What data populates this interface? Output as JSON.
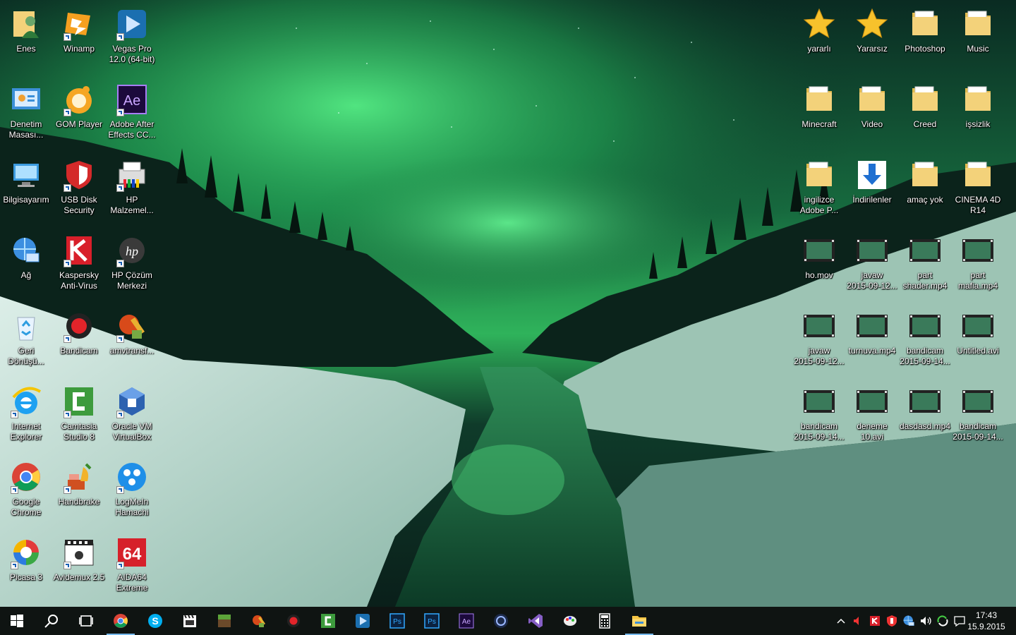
{
  "desktop": {
    "left_icons": [
      {
        "label": "Enes",
        "icon": "user-folder-icon"
      },
      {
        "label": "Winamp",
        "icon": "winamp-icon"
      },
      {
        "label": "Vegas Pro\n12.0 (64-bit)",
        "icon": "vegas-pro-icon"
      },
      {
        "label": "Denetim\nMasası...",
        "icon": "control-panel-icon"
      },
      {
        "label": "GOM Player",
        "icon": "gom-player-icon"
      },
      {
        "label": "Adobe After\nEffects CC...",
        "icon": "after-effects-icon"
      },
      {
        "label": "Bilgisayarım",
        "icon": "computer-icon"
      },
      {
        "label": "USB Disk\nSecurity",
        "icon": "usb-disk-security-icon"
      },
      {
        "label": "HP\nMalzemel...",
        "icon": "hp-printer-icon"
      },
      {
        "label": "Ağ",
        "icon": "network-icon"
      },
      {
        "label": "Kaspersky\nAnti-Virus",
        "icon": "kaspersky-icon"
      },
      {
        "label": "HP Çözüm\nMerkezi",
        "icon": "hp-solution-center-icon"
      },
      {
        "label": "Geri\nDönüşü...",
        "icon": "recycle-bin-icon"
      },
      {
        "label": "Bandicam",
        "icon": "bandicam-icon"
      },
      {
        "label": "amvtransf...",
        "icon": "amvtransformer-icon"
      },
      {
        "label": "Internet\nExplorer",
        "icon": "internet-explorer-icon"
      },
      {
        "label": "Camtasia\nStudio 8",
        "icon": "camtasia-icon"
      },
      {
        "label": "Oracle VM\nVirtualBox",
        "icon": "virtualbox-icon"
      },
      {
        "label": "Google\nChrome",
        "icon": "chrome-icon"
      },
      {
        "label": "Handbrake",
        "icon": "handbrake-icon"
      },
      {
        "label": "LogMeIn\nHamachi",
        "icon": "hamachi-icon"
      },
      {
        "label": "Picasa 3",
        "icon": "picasa-icon"
      },
      {
        "label": "Avidemux 2.5",
        "icon": "avidemux-icon"
      },
      {
        "label": "AIDA64\nExtreme",
        "icon": "aida64-icon"
      }
    ],
    "right_icons": [
      {
        "label": "yararlı",
        "icon": "star-icon"
      },
      {
        "label": "Yararsız",
        "icon": "star-icon"
      },
      {
        "label": "Photoshop",
        "icon": "folder-icon"
      },
      {
        "label": "Music",
        "icon": "folder-icon"
      },
      {
        "label": "Minecraft",
        "icon": "folder-icon"
      },
      {
        "label": "Video",
        "icon": "folder-icon"
      },
      {
        "label": "Creed",
        "icon": "folder-icon"
      },
      {
        "label": "işsizlik",
        "icon": "folder-icon"
      },
      {
        "label": "ingilizce\nAdobe P...",
        "icon": "folder-icon"
      },
      {
        "label": "İndirilenler",
        "icon": "downloads-icon"
      },
      {
        "label": "amaç yok",
        "icon": "folder-icon"
      },
      {
        "label": "CINEMA 4D\nR14",
        "icon": "folder-icon"
      },
      {
        "label": "ho.mov",
        "icon": "video-file-icon"
      },
      {
        "label": "javaw\n2015-09-12...",
        "icon": "video-file-icon"
      },
      {
        "label": "part\nshader.mp4",
        "icon": "video-file-icon"
      },
      {
        "label": "part\nmafia.mp4",
        "icon": "video-file-icon"
      },
      {
        "label": "javaw\n2015-09-12...",
        "icon": "video-file-icon"
      },
      {
        "label": "turnuva.mp4",
        "icon": "video-file-icon"
      },
      {
        "label": "bandicam\n2015-09-14...",
        "icon": "video-file-icon"
      },
      {
        "label": "Untitled.avi",
        "icon": "video-file-icon"
      },
      {
        "label": "bandicam\n2015-09-14...",
        "icon": "video-file-icon"
      },
      {
        "label": "deneme\n10.avi",
        "icon": "video-file-icon"
      },
      {
        "label": "dasdasd.mp4",
        "icon": "video-file-icon"
      },
      {
        "label": "bandicam\n2015-09-14...",
        "icon": "video-file-icon"
      }
    ]
  },
  "taskbar": {
    "buttons": [
      {
        "name": "start-button",
        "icon": "windows-logo-icon"
      },
      {
        "name": "search-button",
        "icon": "search-icon"
      },
      {
        "name": "task-view-button",
        "icon": "task-view-icon"
      },
      {
        "name": "chrome-taskbar-button",
        "icon": "chrome-icon",
        "active": true
      },
      {
        "name": "skype-taskbar-button",
        "icon": "skype-icon"
      },
      {
        "name": "clapper-taskbar-button",
        "icon": "clapperboard-icon"
      },
      {
        "name": "minecraft-taskbar-button",
        "icon": "minecraft-icon"
      },
      {
        "name": "amvtransformer-taskbar-button",
        "icon": "amvtransformer-icon"
      },
      {
        "name": "bandicam-taskbar-button",
        "icon": "bandicam-icon"
      },
      {
        "name": "camtasia-taskbar-button",
        "icon": "camtasia-icon"
      },
      {
        "name": "vegas-taskbar-button",
        "icon": "vegas-pro-icon"
      },
      {
        "name": "photoshop-taskbar-button",
        "icon": "photoshop-icon",
        "text": "Ps"
      },
      {
        "name": "photoshop-cc-taskbar-button",
        "icon": "photoshop-icon",
        "text": "Ps"
      },
      {
        "name": "after-effects-taskbar-button",
        "icon": "after-effects-icon",
        "text": "Ae"
      },
      {
        "name": "cinema4d-taskbar-button",
        "icon": "cinema4d-icon"
      },
      {
        "name": "visual-studio-taskbar-button",
        "icon": "visual-studio-icon"
      },
      {
        "name": "paint-taskbar-button",
        "icon": "paint-icon"
      },
      {
        "name": "calculator-taskbar-button",
        "icon": "calculator-icon"
      },
      {
        "name": "file-explorer-taskbar-button",
        "icon": "file-explorer-icon",
        "active": true
      }
    ],
    "tray": {
      "icons": [
        "chevron-up-icon",
        "volume-mute-icon",
        "kaspersky-tray-icon",
        "shield-icon",
        "network-icon",
        "volume-icon",
        "sync-icon",
        "notification-icon"
      ],
      "time": "17:43",
      "date": "15.9.2015"
    }
  },
  "colors": {
    "aurora": "#3de07a",
    "taskbar": "#0f1412",
    "active_indicator": "#76b9ed"
  }
}
